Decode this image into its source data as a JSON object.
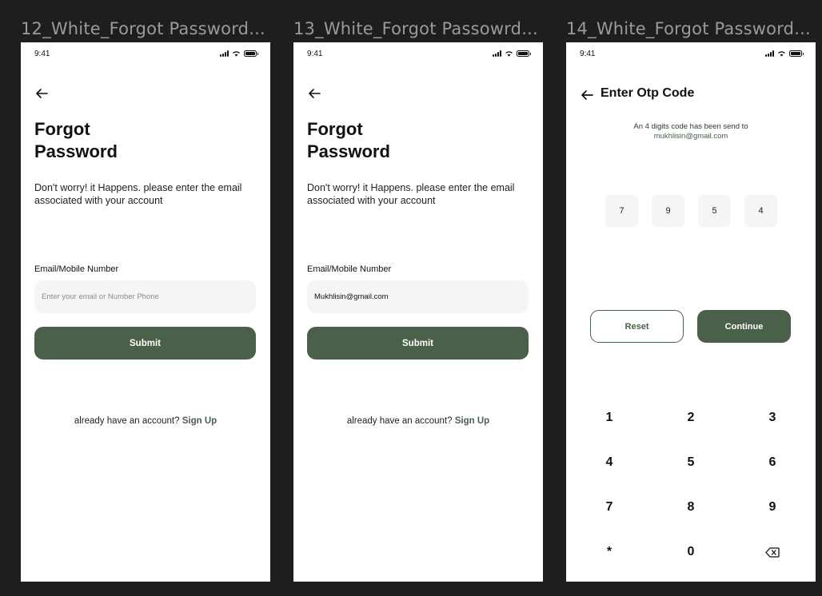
{
  "frames": [
    {
      "label": "12_White_Forgot Password...",
      "status_time": "9:41",
      "title_line1": "Forgot",
      "title_line2": "Password",
      "description": "Don't worry! it Happens. please enter the email associated with your account",
      "field_label": "Email/Mobile Number",
      "input_placeholder": "Enter your email or Number Phone",
      "input_value": "",
      "submit_label": "Submit",
      "signup_prompt": "already have an account?",
      "signup_link": "Sign Up"
    },
    {
      "label": "13_White_Forgot Passowrd...",
      "status_time": "9:41",
      "title_line1": "Forgot",
      "title_line2": "Password",
      "description": "Don't worry! it Happens. please enter the email associated with your account",
      "field_label": "Email/Mobile Number",
      "input_placeholder": "",
      "input_value": "Mukhlisin@gmail.com",
      "submit_label": "Submit",
      "signup_prompt": "already have an account?",
      "signup_link": "Sign Up"
    },
    {
      "label": "14_White_Forgot Password...",
      "status_time": "9:41",
      "title": "Enter Otp Code",
      "info_line": "An 4 digits code has been send to",
      "email": "mukhlisin@gmail.com",
      "otp_digits": [
        "7",
        "9",
        "5",
        "4"
      ],
      "reset_label": "Reset",
      "continue_label": "Continue",
      "keypad": [
        "1",
        "2",
        "3",
        "4",
        "5",
        "6",
        "7",
        "8",
        "9",
        "*",
        "0"
      ]
    }
  ],
  "icons": {
    "back": "arrow-left-icon",
    "signal": "cellular-signal-icon",
    "wifi": "wifi-icon",
    "battery": "battery-icon",
    "backspace": "backspace-icon"
  },
  "colors": {
    "background": "#1e1e1e",
    "screen": "#ffffff",
    "primary": "#4b604b",
    "input_bg": "#f5f5f5",
    "frame_label": "#9a9a9a"
  }
}
